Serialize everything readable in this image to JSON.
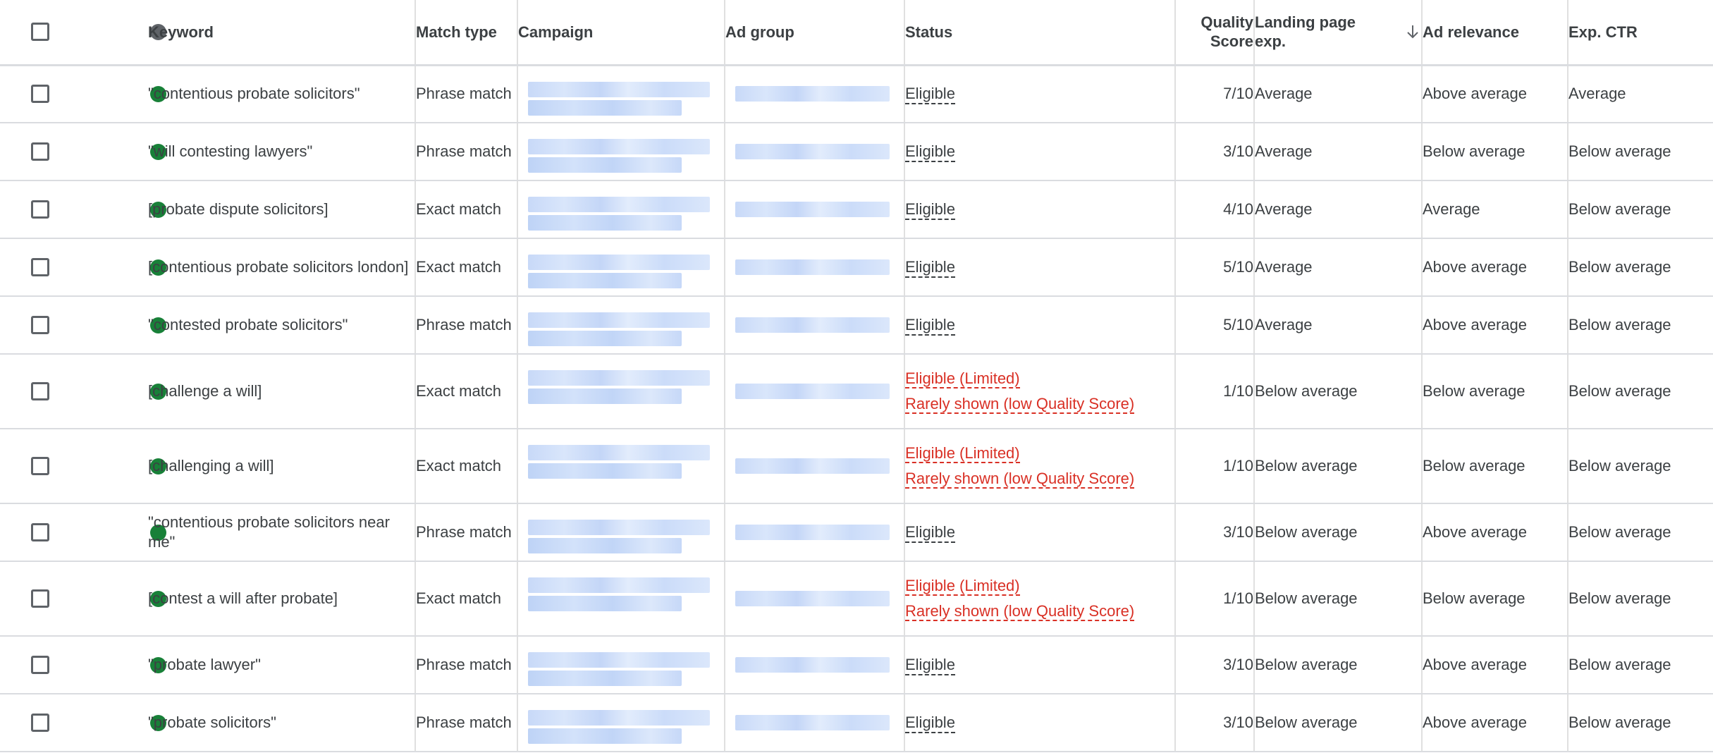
{
  "header": {
    "keyword": "Keyword",
    "match_type": "Match type",
    "campaign": "Campaign",
    "ad_group": "Ad group",
    "status": "Status",
    "quality_score": "Quality Score",
    "landing_page_exp": "Landing page exp.",
    "ad_relevance": "Ad relevance",
    "exp_ctr": "Exp. CTR"
  },
  "colors": {
    "enabled_dot": "#188038",
    "header_dot": "#5f6368",
    "limited_status": "#d93025",
    "redaction": "#c8d9f8"
  },
  "icons": {
    "sort": "arrow-down-icon",
    "status": "status-dot-icon",
    "select": "checkbox-icon"
  },
  "rows": [
    {
      "keyword": "\"contentious probate solicitors\"",
      "match_type": "Phrase match",
      "status": [
        "Eligible"
      ],
      "limited": false,
      "quality_score": "7/10",
      "landing_page": "Average",
      "ad_relevance": "Above average",
      "exp_ctr": "Average"
    },
    {
      "keyword": "\"will contesting lawyers\"",
      "match_type": "Phrase match",
      "status": [
        "Eligible"
      ],
      "limited": false,
      "quality_score": "3/10",
      "landing_page": "Average",
      "ad_relevance": "Below average",
      "exp_ctr": "Below average"
    },
    {
      "keyword": "[probate dispute solicitors]",
      "match_type": "Exact match",
      "status": [
        "Eligible"
      ],
      "limited": false,
      "quality_score": "4/10",
      "landing_page": "Average",
      "ad_relevance": "Average",
      "exp_ctr": "Below average"
    },
    {
      "keyword": "[contentious probate solicitors london]",
      "match_type": "Exact match",
      "status": [
        "Eligible"
      ],
      "limited": false,
      "quality_score": "5/10",
      "landing_page": "Average",
      "ad_relevance": "Above average",
      "exp_ctr": "Below average"
    },
    {
      "keyword": "\"contested probate solicitors\"",
      "match_type": "Phrase match",
      "status": [
        "Eligible"
      ],
      "limited": false,
      "quality_score": "5/10",
      "landing_page": "Average",
      "ad_relevance": "Above average",
      "exp_ctr": "Below average"
    },
    {
      "keyword": "[challenge a will]",
      "match_type": "Exact match",
      "status": [
        "Eligible (Limited)",
        "Rarely shown (low Quality Score)"
      ],
      "limited": true,
      "quality_score": "1/10",
      "landing_page": "Below average",
      "ad_relevance": "Below average",
      "exp_ctr": "Below average"
    },
    {
      "keyword": "[challenging a will]",
      "match_type": "Exact match",
      "status": [
        "Eligible (Limited)",
        "Rarely shown (low Quality Score)"
      ],
      "limited": true,
      "quality_score": "1/10",
      "landing_page": "Below average",
      "ad_relevance": "Below average",
      "exp_ctr": "Below average"
    },
    {
      "keyword": "\"contentious probate solicitors near me\"",
      "match_type": "Phrase match",
      "status": [
        "Eligible"
      ],
      "limited": false,
      "quality_score": "3/10",
      "landing_page": "Below average",
      "ad_relevance": "Above average",
      "exp_ctr": "Below average"
    },
    {
      "keyword": "[contest a will after probate]",
      "match_type": "Exact match",
      "status": [
        "Eligible (Limited)",
        "Rarely shown (low Quality Score)"
      ],
      "limited": true,
      "quality_score": "1/10",
      "landing_page": "Below average",
      "ad_relevance": "Below average",
      "exp_ctr": "Below average"
    },
    {
      "keyword": "\"probate lawyer\"",
      "match_type": "Phrase match",
      "status": [
        "Eligible"
      ],
      "limited": false,
      "quality_score": "3/10",
      "landing_page": "Below average",
      "ad_relevance": "Above average",
      "exp_ctr": "Below average"
    },
    {
      "keyword": "\"probate solicitors\"",
      "match_type": "Phrase match",
      "status": [
        "Eligible"
      ],
      "limited": false,
      "quality_score": "3/10",
      "landing_page": "Below average",
      "ad_relevance": "Above average",
      "exp_ctr": "Below average"
    }
  ]
}
